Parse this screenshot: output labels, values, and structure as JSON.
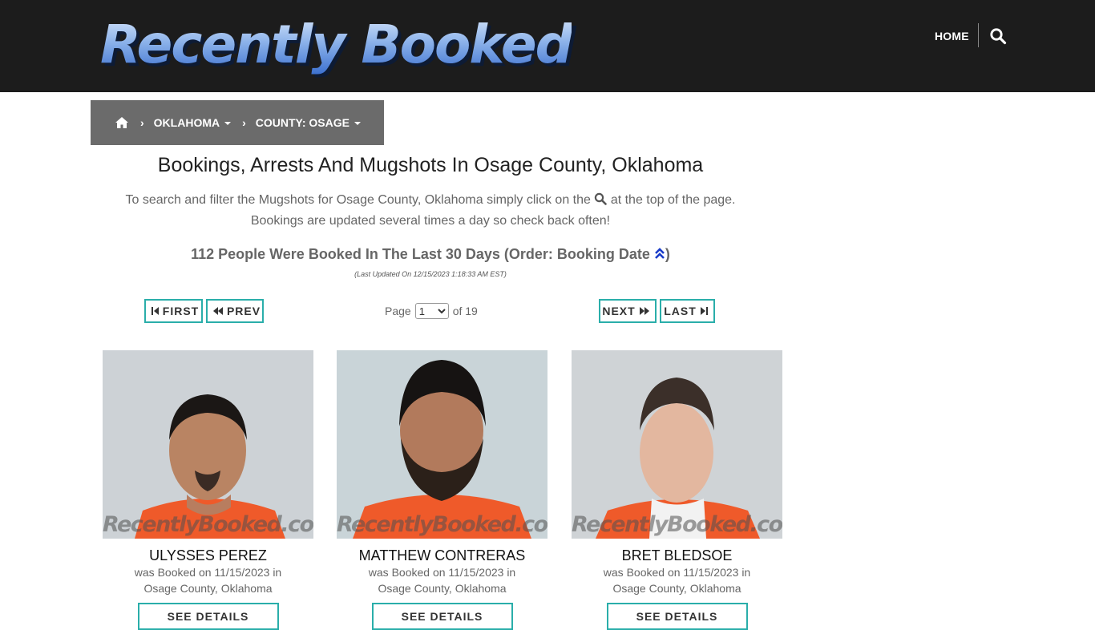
{
  "header": {
    "logo_text": "Recently Booked",
    "nav_home": "HOME",
    "search_icon": "search-icon"
  },
  "breadcrumb": {
    "home_icon": "home-icon",
    "items": [
      {
        "label": "OKLAHOMA"
      },
      {
        "label": "COUNTY: OSAGE"
      }
    ]
  },
  "main": {
    "title": "Bookings, Arrests And Mugshots In Osage County, Oklahoma",
    "intro_part1": "To search and filter the Mugshots for Osage County, Oklahoma simply click on the",
    "intro_part2": "at the top of the page.",
    "intro_line2": "Bookings are updated several times a day so check back often!",
    "count_text": "112 People Were Booked In The Last 30 Days (Order: Booking Date",
    "count_close": ")",
    "updated": "(Last Updated On 12/15/2023 1:18:33 AM EST)"
  },
  "pagination": {
    "first": "FIRST",
    "prev": "PREV",
    "next": "NEXT",
    "last": "LAST",
    "page_label": "Page",
    "current_page": "1",
    "of_label": "of 19"
  },
  "cards": [
    {
      "name": "ULYSSES PEREZ",
      "booked_line1": "was Booked on 11/15/2023 in",
      "booked_line2": "Osage County, Oklahoma",
      "button": "SEE DETAILS",
      "watermark": "RecentlyBooked.com"
    },
    {
      "name": "MATTHEW CONTRERAS",
      "booked_line1": "was Booked on 11/15/2023 in",
      "booked_line2": "Osage County, Oklahoma",
      "button": "SEE DETAILS",
      "watermark": "RecentlyBooked.com"
    },
    {
      "name": "BRET BLEDSOE",
      "booked_line1": "was Booked on 11/15/2023 in",
      "booked_line2": "Osage County, Oklahoma",
      "button": "SEE DETAILS",
      "watermark": "RecentlyBooked.com"
    }
  ],
  "colors": {
    "header_bg": "#1c1c1c",
    "breadcrumb_bg": "#6b6b6b",
    "accent_teal": "#2aaeaa",
    "sort_icon_blue": "#1a3cc9"
  }
}
